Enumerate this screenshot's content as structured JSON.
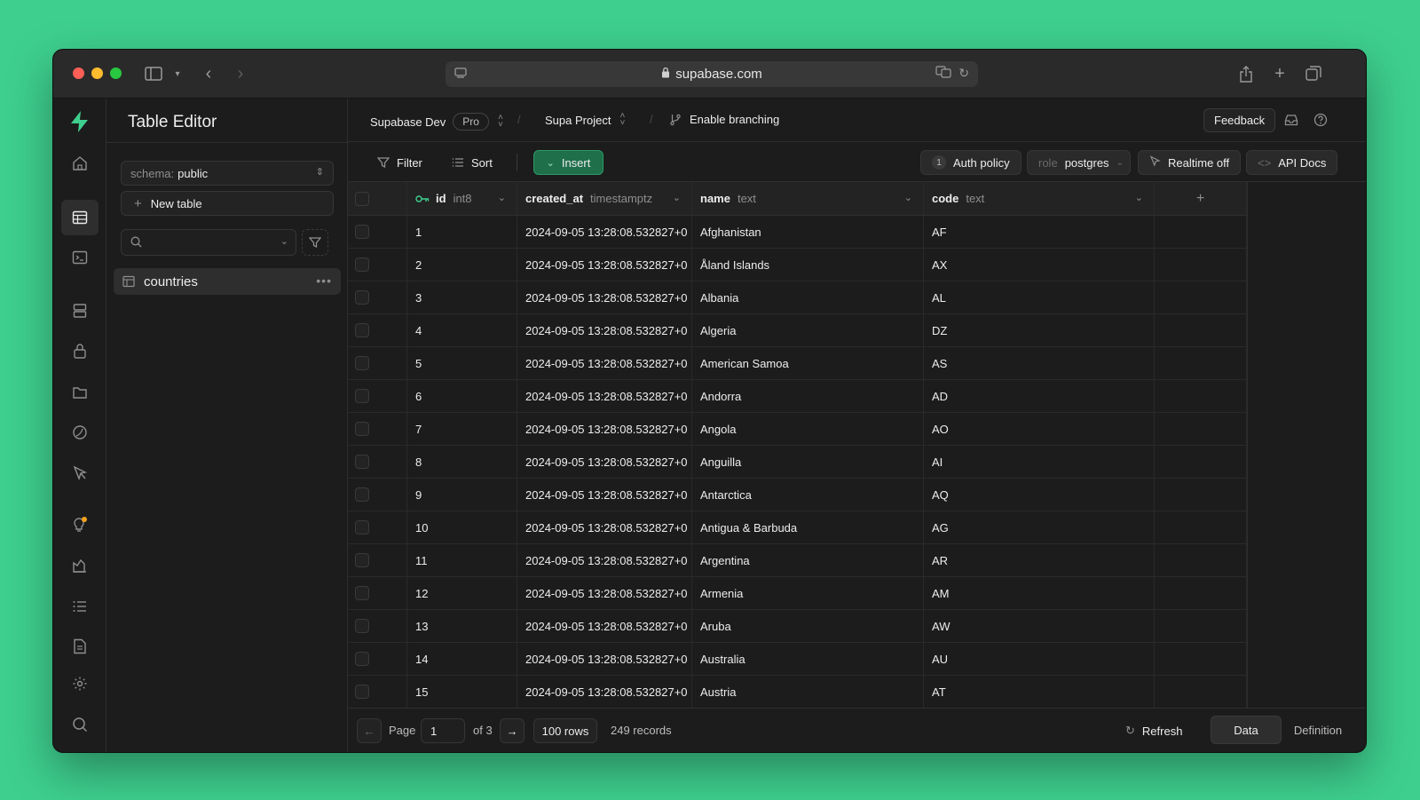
{
  "browser": {
    "url": "supabase.com"
  },
  "sidebar": {
    "title": "Table Editor",
    "schema_prefix": "schema:",
    "schema_value": "public",
    "new_table_label": "New table",
    "search_placeholder": "",
    "tables": [
      {
        "name": "countries"
      }
    ]
  },
  "breadcrumb": {
    "org": "Supabase Dev",
    "plan_badge": "Pro",
    "project": "Supa Project",
    "branching": "Enable branching"
  },
  "topbar": {
    "feedback_label": "Feedback"
  },
  "toolbar": {
    "filter_label": "Filter",
    "sort_label": "Sort",
    "insert_label": "Insert",
    "auth_policy_count": "1",
    "auth_policy_label": "Auth policy",
    "role_prefix": "role",
    "role_value": "postgres",
    "realtime_label": "Realtime off",
    "api_docs_label": "API Docs"
  },
  "grid": {
    "columns": [
      {
        "name": "id",
        "type": "int8",
        "primary_key": true
      },
      {
        "name": "created_at",
        "type": "timestamptz"
      },
      {
        "name": "name",
        "type": "text"
      },
      {
        "name": "code",
        "type": "text"
      }
    ],
    "add_column_label": "+",
    "rows": [
      {
        "id": "1",
        "created_at": "2024-09-05 13:28:08.532827+0",
        "name": "Afghanistan",
        "code": "AF"
      },
      {
        "id": "2",
        "created_at": "2024-09-05 13:28:08.532827+0",
        "name": "Åland Islands",
        "code": "AX"
      },
      {
        "id": "3",
        "created_at": "2024-09-05 13:28:08.532827+0",
        "name": "Albania",
        "code": "AL"
      },
      {
        "id": "4",
        "created_at": "2024-09-05 13:28:08.532827+0",
        "name": "Algeria",
        "code": "DZ"
      },
      {
        "id": "5",
        "created_at": "2024-09-05 13:28:08.532827+0",
        "name": "American Samoa",
        "code": "AS"
      },
      {
        "id": "6",
        "created_at": "2024-09-05 13:28:08.532827+0",
        "name": "Andorra",
        "code": "AD"
      },
      {
        "id": "7",
        "created_at": "2024-09-05 13:28:08.532827+0",
        "name": "Angola",
        "code": "AO"
      },
      {
        "id": "8",
        "created_at": "2024-09-05 13:28:08.532827+0",
        "name": "Anguilla",
        "code": "AI"
      },
      {
        "id": "9",
        "created_at": "2024-09-05 13:28:08.532827+0",
        "name": "Antarctica",
        "code": "AQ"
      },
      {
        "id": "10",
        "created_at": "2024-09-05 13:28:08.532827+0",
        "name": "Antigua & Barbuda",
        "code": "AG"
      },
      {
        "id": "11",
        "created_at": "2024-09-05 13:28:08.532827+0",
        "name": "Argentina",
        "code": "AR"
      },
      {
        "id": "12",
        "created_at": "2024-09-05 13:28:08.532827+0",
        "name": "Armenia",
        "code": "AM"
      },
      {
        "id": "13",
        "created_at": "2024-09-05 13:28:08.532827+0",
        "name": "Aruba",
        "code": "AW"
      },
      {
        "id": "14",
        "created_at": "2024-09-05 13:28:08.532827+0",
        "name": "Australia",
        "code": "AU"
      },
      {
        "id": "15",
        "created_at": "2024-09-05 13:28:08.532827+0",
        "name": "Austria",
        "code": "AT"
      }
    ]
  },
  "footer": {
    "page_label": "Page",
    "page_value": "1",
    "page_of": "of 3",
    "rows_per_page": "100 rows",
    "records": "249 records",
    "refresh_label": "Refresh",
    "tab_data": "Data",
    "tab_definition": "Definition"
  },
  "colors": {
    "accent": "#3ecf8e",
    "background": "#1c1c1c",
    "insert_bg": "#1f6f4a"
  },
  "icons": {
    "iconbar": [
      "home-icon",
      "table-editor-icon",
      "sql-editor-icon",
      "database-icon",
      "auth-icon",
      "storage-icon",
      "edge-functions-icon",
      "realtime-icon",
      "advisors-icon",
      "reports-icon",
      "logs-icon",
      "api-docs-icon",
      "settings-icon",
      "search-icon"
    ]
  }
}
